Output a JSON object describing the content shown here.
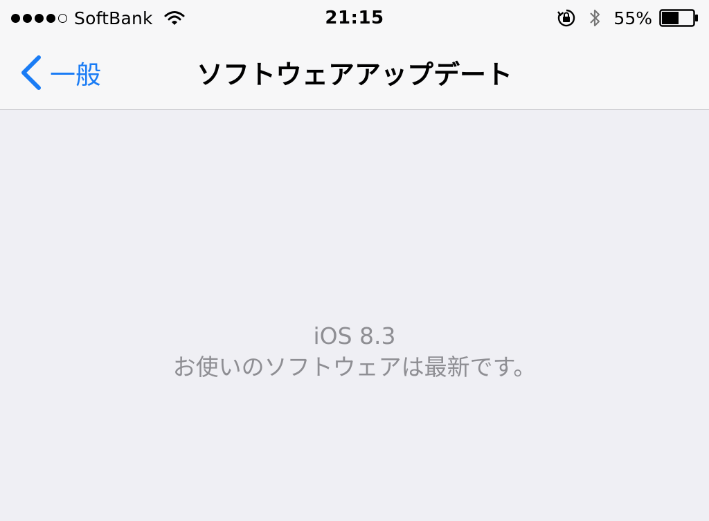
{
  "status_bar": {
    "carrier": "SoftBank",
    "time": "21:15",
    "battery_percent": "55%",
    "battery_level": 0.55,
    "signal_bars_filled": 4,
    "signal_bars_total": 5,
    "icons": [
      "wifi-icon",
      "orientation-lock-icon",
      "bluetooth-icon",
      "battery-icon"
    ]
  },
  "nav": {
    "back_label": "一般",
    "title": "ソフトウェアアップデート"
  },
  "content": {
    "ios_version": "iOS 8.3",
    "status_message": "お使いのソフトウェアは最新です。"
  },
  "colors": {
    "accent": "#1a7cf5",
    "background": "#efeff4",
    "secondary_text": "#8e8e93"
  }
}
